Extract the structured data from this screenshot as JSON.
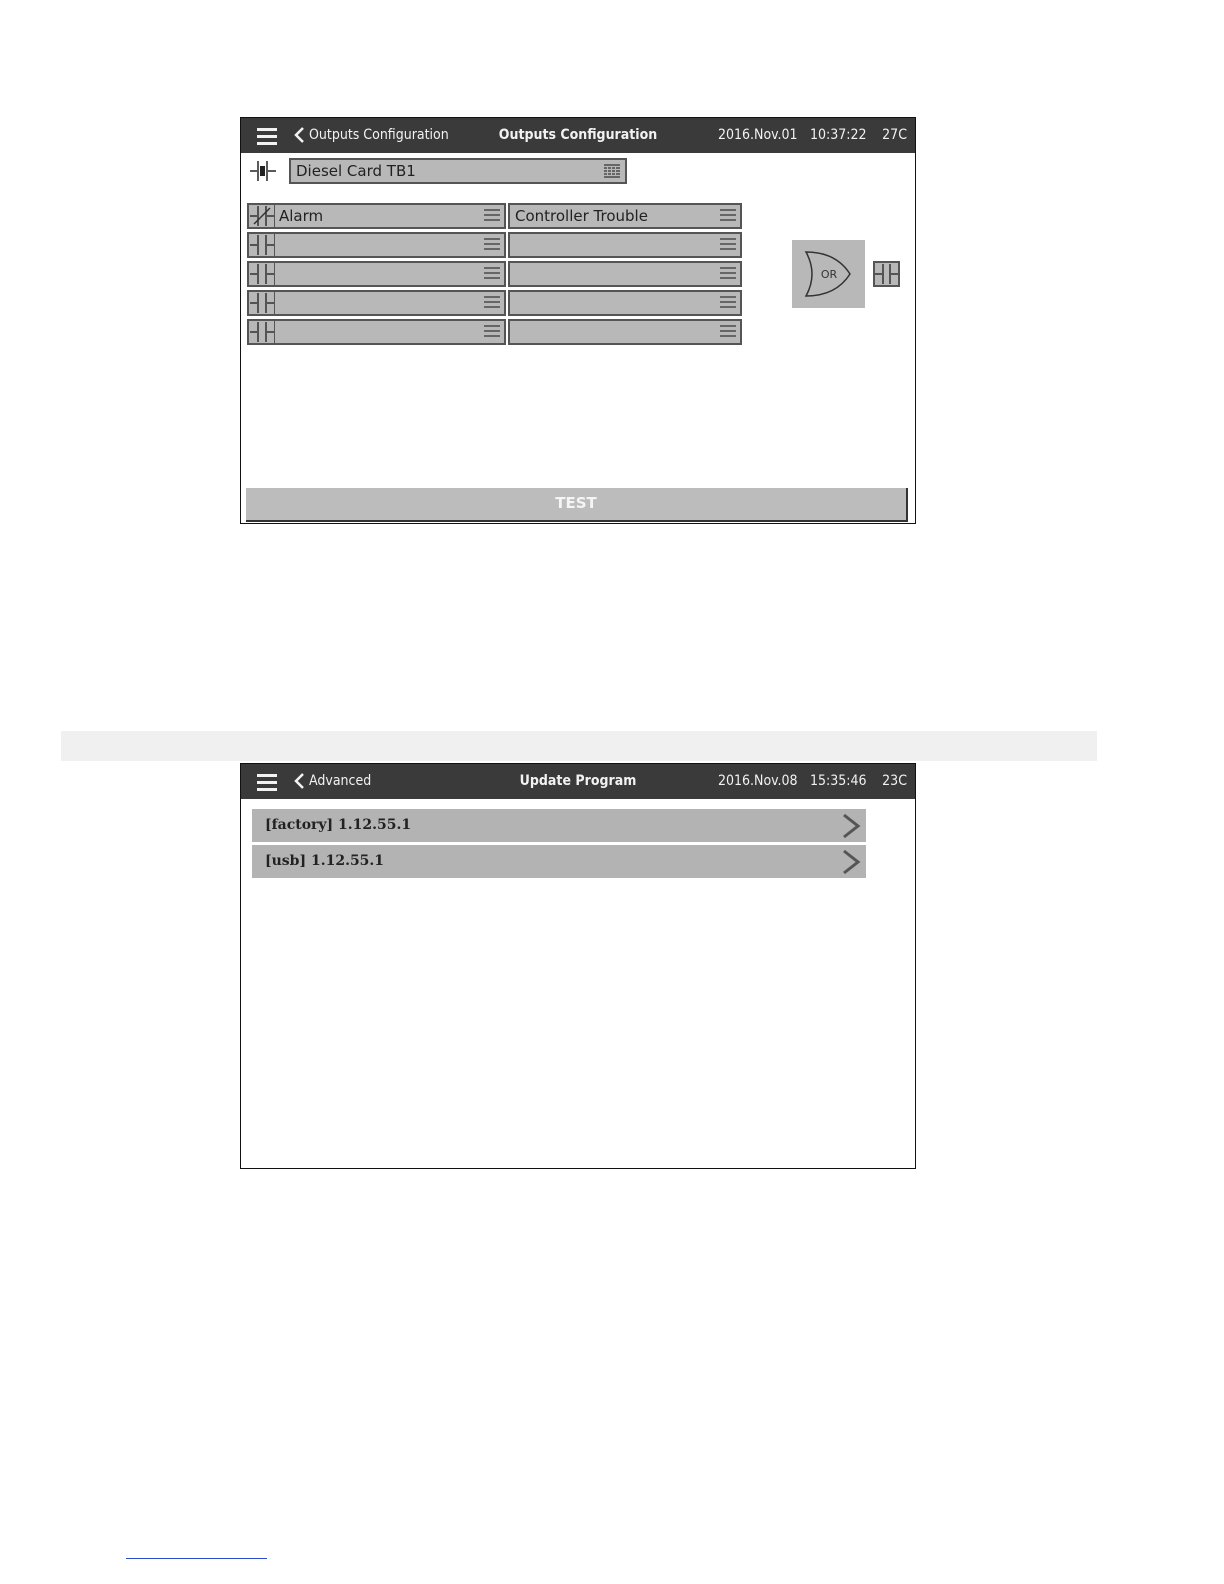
{
  "screen1": {
    "header": {
      "back_label": "Outputs Configuration",
      "title": "Outputs Configuration",
      "date": "2016.Nov.01",
      "time": "10:37:22",
      "temperature": "27C"
    },
    "card_select": "Diesel Card TB1",
    "rows": [
      {
        "left": "Alarm",
        "right": "Controller Trouble",
        "left_contact": "normally-closed-contact-icon"
      },
      {
        "left": "",
        "right": "",
        "left_contact": "normally-open-contact-icon"
      },
      {
        "left": "",
        "right": "",
        "left_contact": "normally-open-contact-icon"
      },
      {
        "left": "",
        "right": "",
        "left_contact": "normally-open-contact-icon"
      },
      {
        "left": "",
        "right": "",
        "left_contact": "normally-open-contact-icon"
      }
    ],
    "logic_gate": "OR",
    "test_button": "TEST"
  },
  "screen2": {
    "header": {
      "back_label": "Advanced",
      "title": "Update Program",
      "date": "2016.Nov.08",
      "time": "15:35:46",
      "temperature": "23C"
    },
    "programs": [
      {
        "label": "[factory] 1.12.55.1"
      },
      {
        "label": "[usb] 1.12.55.1"
      }
    ]
  }
}
